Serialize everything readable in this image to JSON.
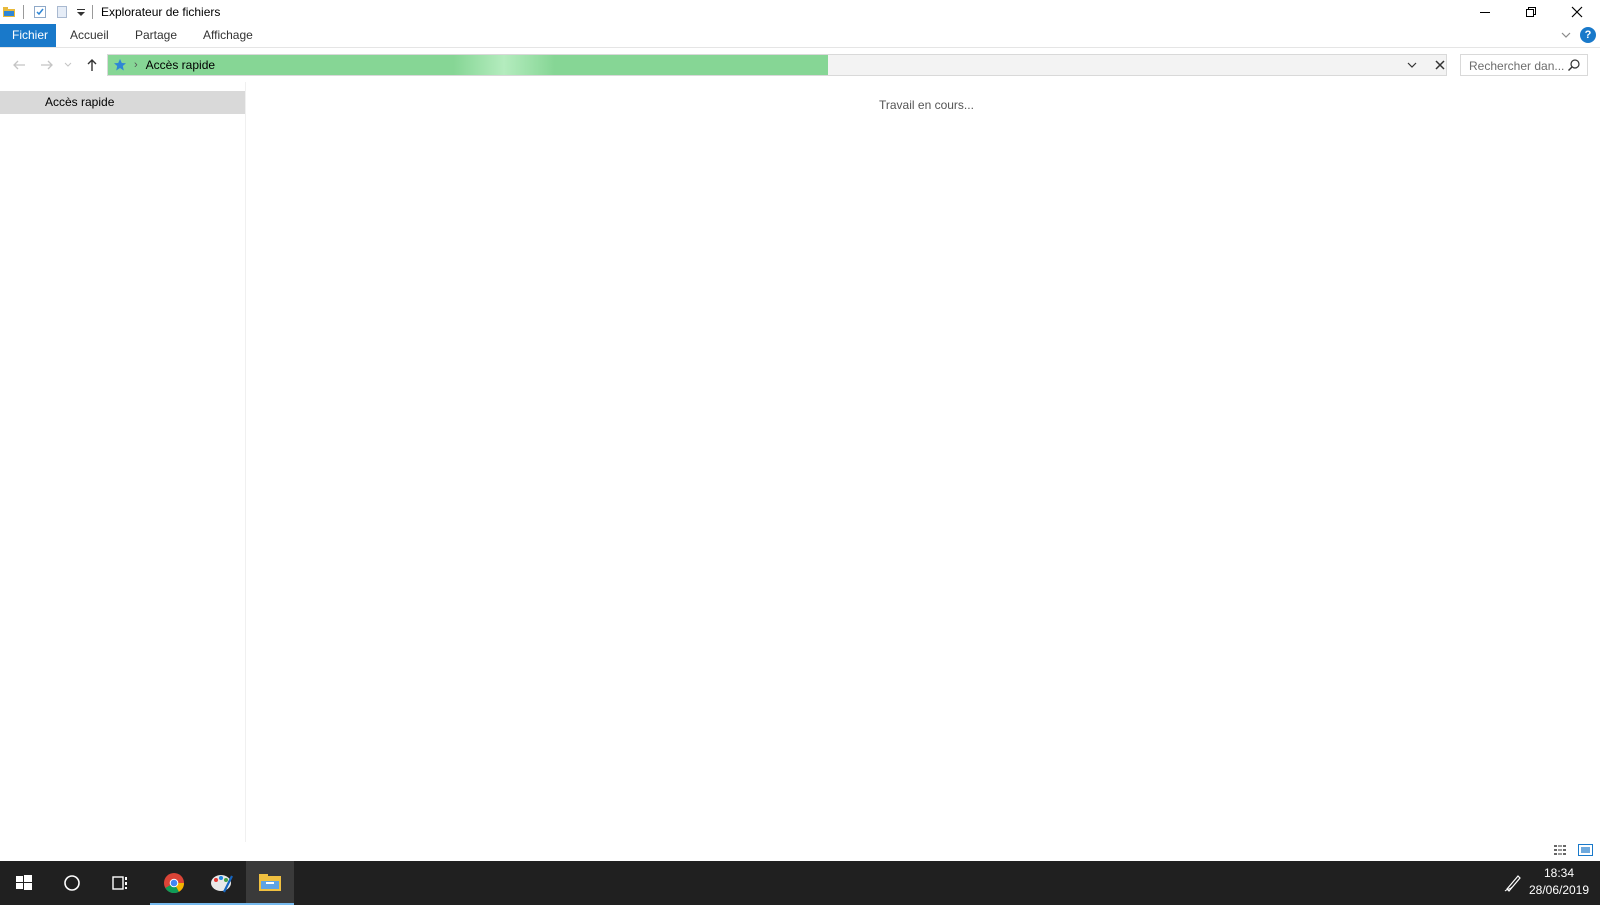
{
  "window": {
    "title": "Explorateur de fichiers",
    "accent_color": "#1979ca"
  },
  "ribbon": {
    "tabs": [
      {
        "label": "Fichier",
        "active": true
      },
      {
        "label": "Accueil"
      },
      {
        "label": "Partage"
      },
      {
        "label": "Affichage"
      }
    ],
    "help_label": "?"
  },
  "address_bar": {
    "location": "Accès rapide",
    "loading": true,
    "progress_color": "#86d695"
  },
  "search": {
    "placeholder": "Rechercher dan..."
  },
  "sidebar": {
    "items": [
      {
        "label": "Accès rapide",
        "selected": true
      }
    ]
  },
  "content": {
    "status_text": "Travail en cours..."
  },
  "taskbar": {
    "apps": [
      "start-icon",
      "cortana-icon",
      "task-view-icon",
      "chrome-icon",
      "paint-icon",
      "file-explorer-icon"
    ],
    "clock": {
      "time": "18:34",
      "date": "28/06/2019"
    }
  }
}
